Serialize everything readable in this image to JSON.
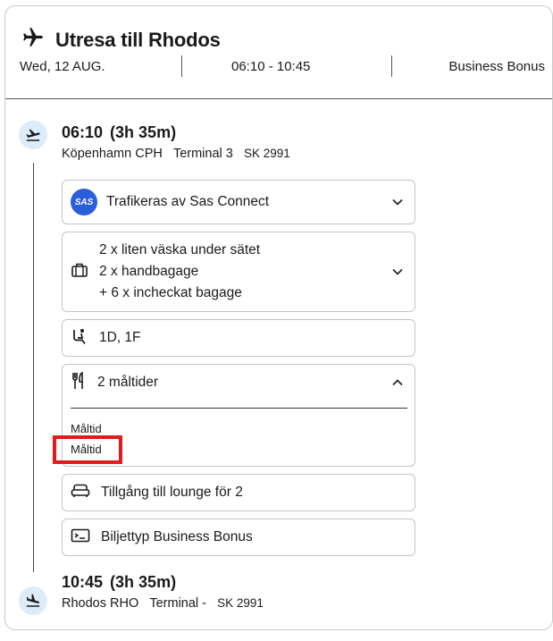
{
  "header": {
    "title": "Utresa till Rhodos",
    "date": "Wed, 12 AUG.",
    "time_range": "06:10 - 10:45",
    "fare_class": "Business Bonus"
  },
  "departure": {
    "time": "06:10",
    "duration": "(3h 35m)",
    "city": "Köpenhamn",
    "code": "CPH",
    "terminal_label": "Terminal",
    "terminal": "3",
    "flight": "SK 2991"
  },
  "operator": {
    "logo_text": "SAS",
    "label": "Trafikeras av Sas Connect"
  },
  "baggage": {
    "lines": [
      "2 x liten väska under sätet",
      "2 x handbagage",
      "+ 6 x incheckat bagage"
    ]
  },
  "seats": {
    "label": "1D, 1F"
  },
  "meals": {
    "label": "2 måltider",
    "items": [
      "Måltid",
      "Måltid"
    ]
  },
  "lounge": {
    "label": "Tillgång till lounge för 2"
  },
  "ticket": {
    "label": "Biljettyp Business Bonus"
  },
  "arrival": {
    "time": "10:45",
    "duration": "(3h 35m)",
    "city": "Rhodos",
    "code": "RHO",
    "terminal_label": "Terminal",
    "terminal": "-",
    "flight": "SK 2991"
  },
  "colors": {
    "accent_blue": "#2a5fdc",
    "dot_bg": "#dcecf8",
    "highlight_red": "#e01b1b"
  }
}
